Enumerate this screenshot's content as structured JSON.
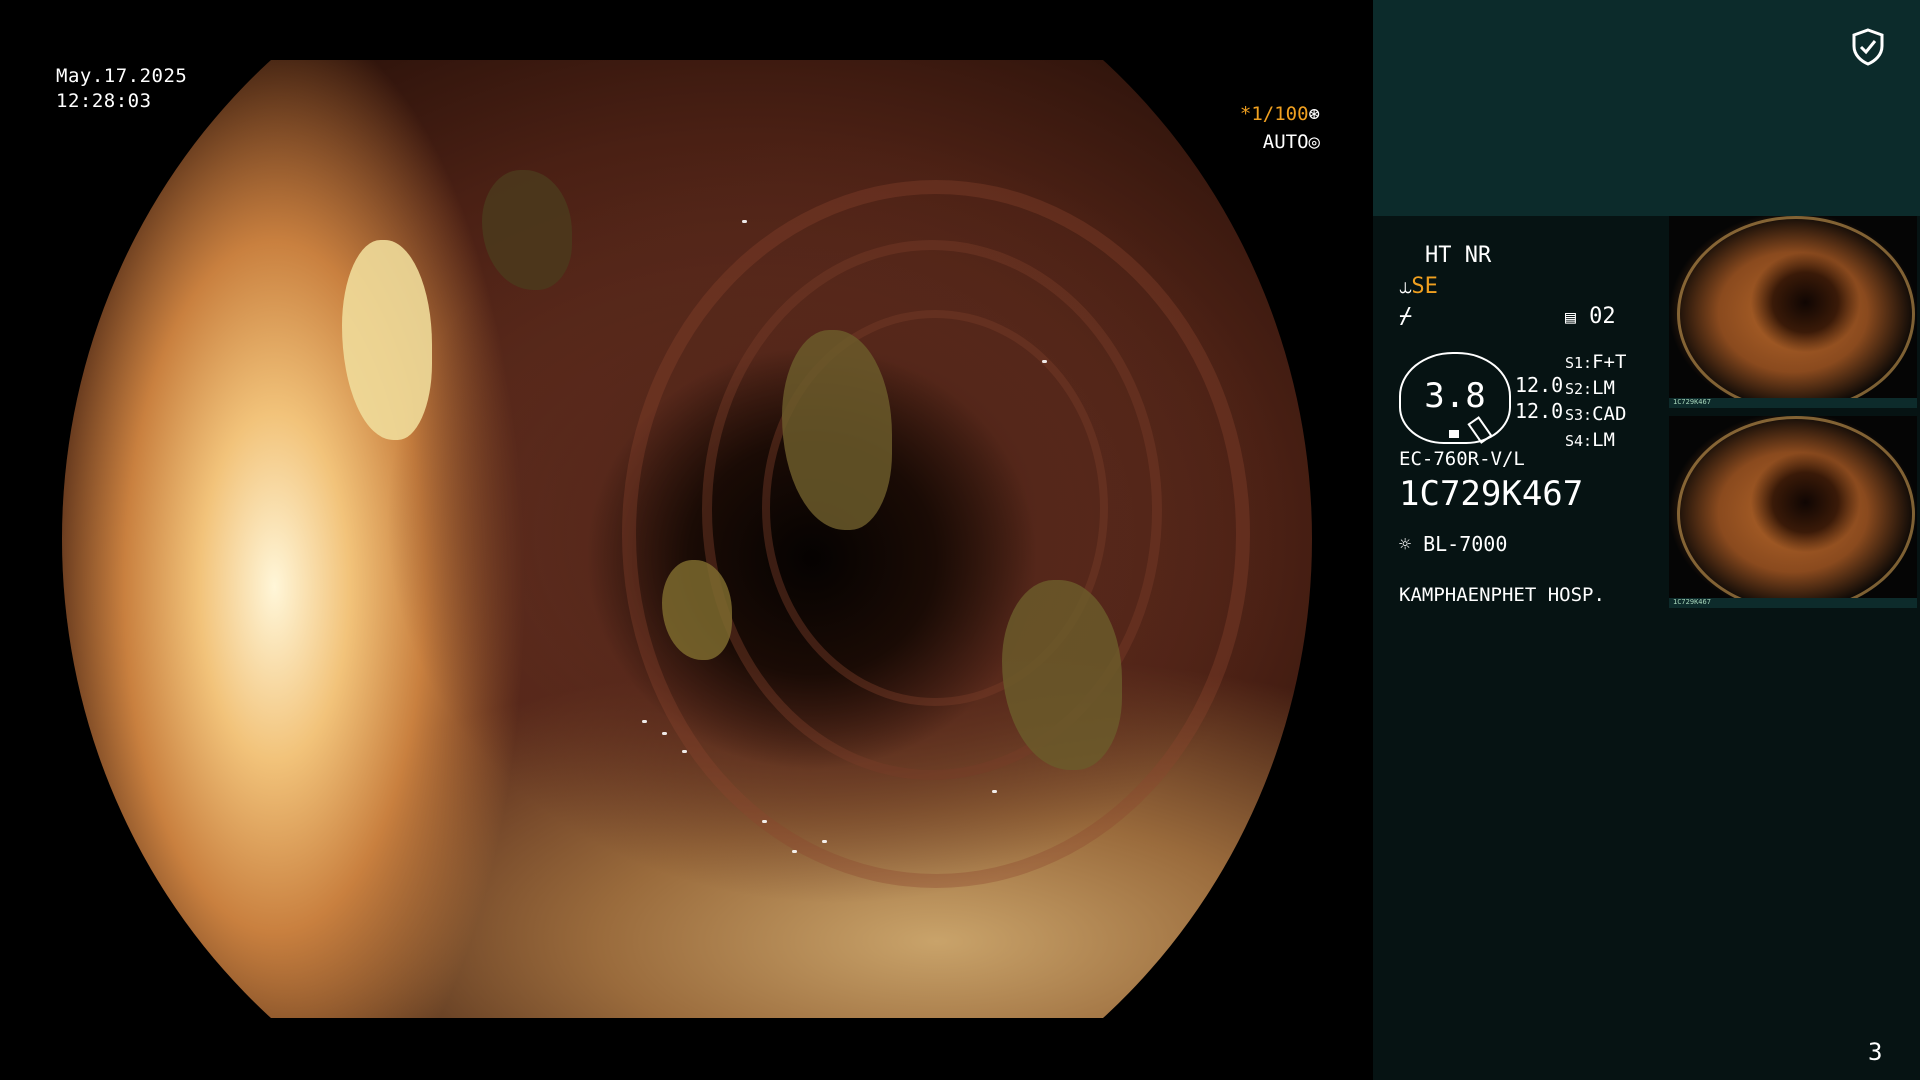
{
  "video": {
    "date": "May.17.2025",
    "time": "12:28:03",
    "shutter": "*1/100",
    "exposure_mode": "AUTO"
  },
  "panel": {
    "mode_top": "HT NR",
    "mode_se": "SE",
    "channel": "02",
    "gauge_value": "3.8",
    "val1": "12.0",
    "val2": "12.0",
    "slots": [
      {
        "key": "S1:",
        "value": "F+T"
      },
      {
        "key": "S2:",
        "value": "LM"
      },
      {
        "key": "S3:",
        "value": "CAD"
      },
      {
        "key": "S4:",
        "value": "LM"
      }
    ],
    "scope_model": "EC-760R-V/L",
    "serial": "1C729K467",
    "light_source": "BL-7000",
    "hospital": "KAMPHAENPHET HOSP.",
    "thumb1_caption": "1C729K467",
    "thumb2_caption": "1C729K467"
  },
  "page_number": "3",
  "colors": {
    "accent_orange": "#f0a020",
    "panel_bg": "#061313",
    "panel_top_bg": "#0c2b2b"
  },
  "icons": [
    "shield-check-icon",
    "scope-icon",
    "lightning-icon",
    "channel-icon",
    "light-source-icon"
  ]
}
